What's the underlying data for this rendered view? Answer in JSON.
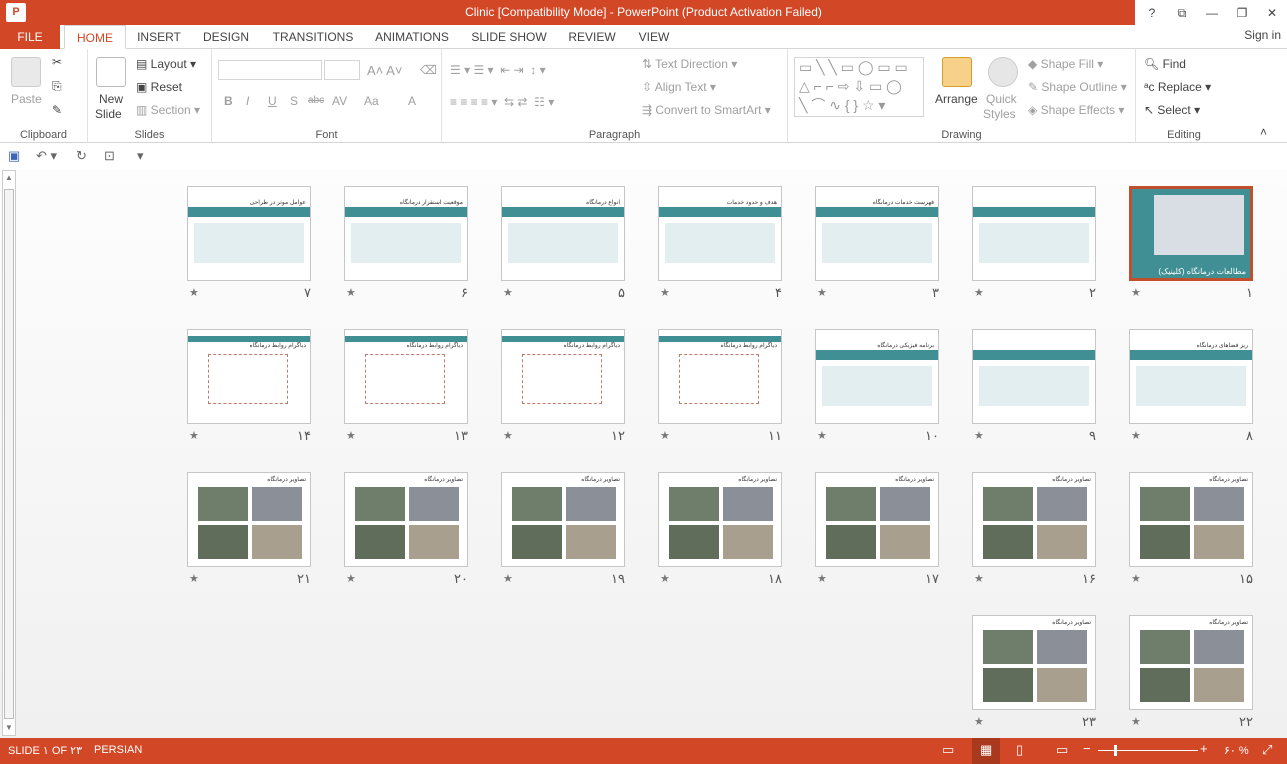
{
  "window": {
    "title": "Clinic [Compatibility Mode] -  PowerPoint (Product Activation Failed)",
    "app_icon": "P",
    "controls": [
      "?",
      "⧉",
      "—",
      "❐",
      "✕"
    ]
  },
  "tabs": [
    "FILE",
    "HOME",
    "INSERT",
    "DESIGN",
    "TRANSITIONS",
    "ANIMATIONS",
    "SLIDE SHOW",
    "REVIEW",
    "VIEW"
  ],
  "active_tab": "HOME",
  "signin": "Sign in",
  "ribbon": {
    "clipboard": {
      "label": "Clipboard",
      "paste": "Paste"
    },
    "slides": {
      "label": "Slides",
      "new_slide_1": "New",
      "new_slide_2": "Slide",
      "layout": "Layout",
      "reset": "Reset",
      "section": "Section"
    },
    "font": {
      "label": "Font",
      "bold": "B",
      "italic": "I",
      "underline": "U",
      "shadow": "S",
      "strike": "abc",
      "spacing": "AV",
      "case": "Aa",
      "color": "A"
    },
    "paragraph": {
      "label": "Paragraph",
      "text_direction": "Text Direction",
      "align_text": "Align Text",
      "convert": "Convert to SmartArt"
    },
    "drawing": {
      "label": "Drawing",
      "arrange": "Arrange",
      "quick_styles_1": "Quick",
      "quick_styles_2": "Styles",
      "shape_fill": "Shape Fill",
      "shape_outline": "Shape Outline",
      "shape_effects": "Shape Effects"
    },
    "editing": {
      "label": "Editing",
      "find": "Find",
      "replace": "Replace",
      "select": "Select"
    }
  },
  "slides": [
    {
      "n": "١",
      "title": "مطالعات درمانگاه (کلینیک)"
    },
    {
      "n": "٢",
      "title": ""
    },
    {
      "n": "٣",
      "title": "فهرست خدمات درمانگاه"
    },
    {
      "n": "۴",
      "title": "هدف و حدود خدمات"
    },
    {
      "n": "۵",
      "title": "انواع درمانگاه"
    },
    {
      "n": "۶",
      "title": "موقعیت استقرار درمانگاه"
    },
    {
      "n": "٧",
      "title": "عوامل موثر در طراحی"
    },
    {
      "n": "٨",
      "title": "ریز فضاهای درمانگاه"
    },
    {
      "n": "٩",
      "title": ""
    },
    {
      "n": "١٠",
      "title": "برنامه فیزیکی درمانگاه"
    },
    {
      "n": "١١",
      "title": "دیاگرام روابط درمانگاه"
    },
    {
      "n": "١٢",
      "title": "دیاگرام روابط درمانگاه"
    },
    {
      "n": "١٣",
      "title": "دیاگرام روابط درمانگاه"
    },
    {
      "n": "١۴",
      "title": "دیاگرام روابط درمانگاه"
    },
    {
      "n": "١۵",
      "title": "تصاویر درمانگاه"
    },
    {
      "n": "١۶",
      "title": "تصاویر درمانگاه"
    },
    {
      "n": "١٧",
      "title": "تصاویر درمانگاه"
    },
    {
      "n": "١٨",
      "title": "تصاویر درمانگاه"
    },
    {
      "n": "١٩",
      "title": "تصاویر درمانگاه"
    },
    {
      "n": "٢٠",
      "title": "تصاویر درمانگاه"
    },
    {
      "n": "٢١",
      "title": "تصاویر درمانگاه"
    },
    {
      "n": "٢٢",
      "title": "تصاویر درمانگاه"
    },
    {
      "n": "٢٣",
      "title": "تصاویر درمانگاه"
    }
  ],
  "status": {
    "slide": "SLIDE ١ OF ٢٣",
    "language": "PERSIAN",
    "zoom": "۶٠ %"
  },
  "colors": {
    "accent": "#d24726",
    "teal": "#3f8f95",
    "selected": "#c0502d"
  }
}
